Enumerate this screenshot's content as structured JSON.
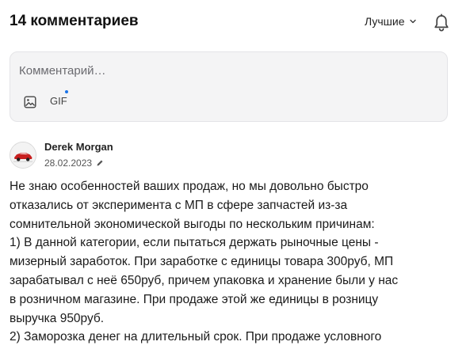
{
  "header": {
    "title": "14 комментариев",
    "sort_label": "Лучшие",
    "sort_icon": "chevron-down-icon",
    "bell_icon": "bell-icon"
  },
  "composer": {
    "placeholder": "Комментарий…",
    "image_icon": "image-icon",
    "gif_label": "GIF"
  },
  "comment": {
    "author": "Derek Morgan",
    "date": "28.02.2023",
    "edited_icon": "pencil-icon",
    "lines": [
      "Не знаю особенностей ваших продаж, но мы довольно быстро",
      "отказались от эксперимента с МП в сфере запчастей из-за",
      "сомнительной экономической выгоды по нескольким причинам:",
      "1) В данной категории, если пытаться держать рыночные цены -",
      "мизерный заработок. При заработке с единицы товара 300руб, МП",
      "зарабатывал с неё 650руб, причем упаковка и хранение были у нас",
      "в розничном магазине. При продаже этой же единицы в розницу",
      "выручка 950руб.",
      "2) Заморозка денег на длительный срок. При продаже условного"
    ]
  },
  "colors": {
    "accent_dot": "#1a73e8",
    "composer_bg": "#f4f4f5",
    "text": "#1a1a1a"
  }
}
